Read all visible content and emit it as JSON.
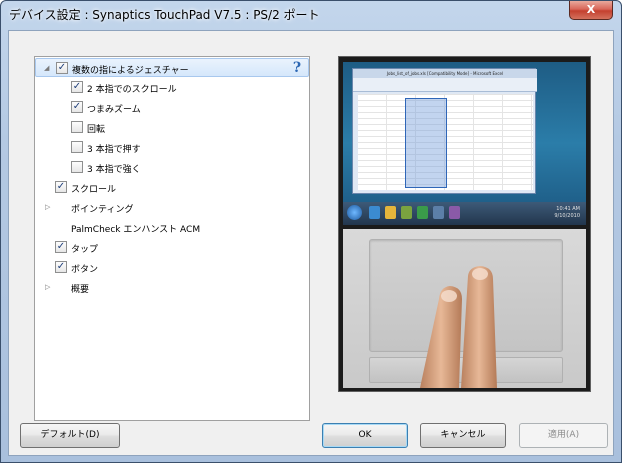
{
  "window": {
    "title": "デバイス設定 : Synaptics TouchPad V7.5 : PS/2 ポート",
    "close_label": "X"
  },
  "tree": {
    "help_label": "?",
    "rows": [
      {
        "label": "複数の指によるジェスチャー",
        "checked": true,
        "expander": "open"
      },
      {
        "label": "2 本指でのスクロール",
        "checked": true
      },
      {
        "label": "つまみズーム",
        "checked": true
      },
      {
        "label": "回転",
        "checked": false
      },
      {
        "label": "3 本指で押す",
        "checked": false
      },
      {
        "label": "3 本指で強く",
        "checked": false
      },
      {
        "label": "スクロール",
        "checked": true
      },
      {
        "label": "ポインティング",
        "expander": "closed"
      },
      {
        "label": "PalmCheck エンハンスト ACM"
      },
      {
        "label": "タップ",
        "checked": true
      },
      {
        "label": "ボタン",
        "checked": true
      },
      {
        "label": "概要",
        "expander": "closed"
      }
    ]
  },
  "preview": {
    "excel_title": "Jobs_list_of_jobs.xls [Compatibility Mode] - Microsoft Excel",
    "clock_time": "10:41 AM",
    "clock_date": "9/10/2010"
  },
  "buttons": {
    "default_label": "デフォルト(D)",
    "ok_label": "OK",
    "cancel_label": "キャンセル",
    "apply_label": "適用(A)"
  },
  "colors": {
    "selection": "#d5e7fb",
    "check": "#1f3f7a",
    "titlebar": "#b4c9e3",
    "close": "#c4402f"
  }
}
